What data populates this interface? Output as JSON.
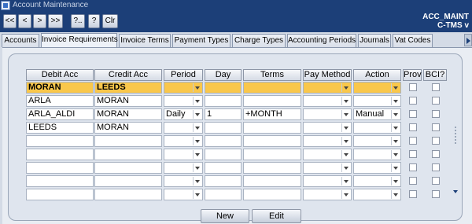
{
  "window": {
    "title": "Account Maintenance"
  },
  "toolbar": {
    "buttons": [
      "<<",
      "<",
      ">",
      ">>",
      "?..",
      "?",
      "Clr"
    ],
    "right_line1": "ACC_MAINT",
    "right_line2": "C-TMS v"
  },
  "tabs": [
    "Accounts",
    "Invoice Requirements",
    "Invoice Terms",
    "Payment Types",
    "Charge Types",
    "Accounting Periods",
    "Journals",
    "Vat Codes"
  ],
  "active_tab": "Invoice Requirements",
  "table": {
    "columns": [
      "Debit Acc",
      "Credit Acc",
      "Period",
      "Day",
      "Terms",
      "Pay Method",
      "Action",
      "Prov",
      "BCI?"
    ],
    "rows": [
      {
        "debit": "MORAN",
        "credit": "LEEDS",
        "period": "",
        "day": "",
        "terms": "",
        "pay_method": "",
        "action": "",
        "selected": true
      },
      {
        "debit": "ARLA",
        "credit": "MORAN",
        "period": "",
        "day": "",
        "terms": "",
        "pay_method": "",
        "action": ""
      },
      {
        "debit": "ARLA_ALDI",
        "credit": "MORAN",
        "period": "Daily",
        "day": "1",
        "terms": "+MONTH",
        "pay_method": "",
        "action": "Manual"
      },
      {
        "debit": "LEEDS",
        "credit": "MORAN",
        "period": "",
        "day": "",
        "terms": "",
        "pay_method": "",
        "action": ""
      },
      {
        "debit": "",
        "credit": "",
        "period": "",
        "day": "",
        "terms": "",
        "pay_method": "",
        "action": ""
      },
      {
        "debit": "",
        "credit": "",
        "period": "",
        "day": "",
        "terms": "",
        "pay_method": "",
        "action": ""
      },
      {
        "debit": "",
        "credit": "",
        "period": "",
        "day": "",
        "terms": "",
        "pay_method": "",
        "action": ""
      },
      {
        "debit": "",
        "credit": "",
        "period": "",
        "day": "",
        "terms": "",
        "pay_method": "",
        "action": ""
      },
      {
        "debit": "",
        "credit": "",
        "period": "",
        "day": "",
        "terms": "",
        "pay_method": "",
        "action": ""
      }
    ]
  },
  "buttons": {
    "new": "New",
    "edit": "Edit"
  },
  "colors": {
    "title_bar": "#1c3f78",
    "selected_row": "#f9c74b"
  }
}
